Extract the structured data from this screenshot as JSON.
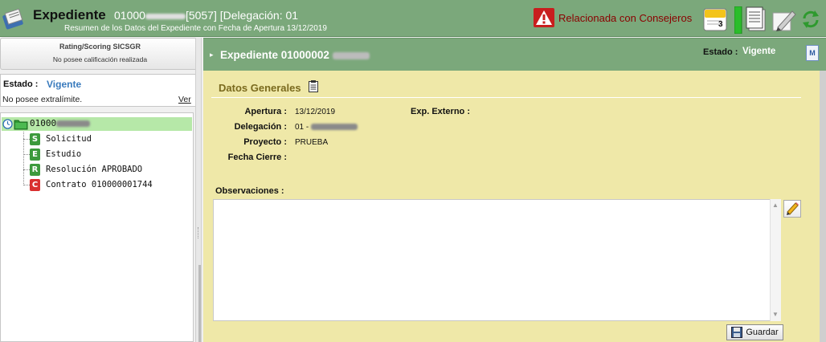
{
  "header": {
    "title": "Expediente",
    "id_prefix": "01000",
    "id_suffix": "[5057] [Delegación: 01",
    "subtitle": "Resumen de los Datos del Expediente con Fecha de Apertura 13/12/2019",
    "alert_label": "Relacionada con Consejeros",
    "calendar_number": "3",
    "tools": [
      "notebook-icon",
      "progress-bar-icon",
      "document-icon",
      "edit-pencil-icon",
      "refresh-icon"
    ]
  },
  "rating": {
    "title": "Rating/Scoring SICSGR",
    "text": "No posee calificación realizada"
  },
  "estado_panel": {
    "label": "Estado :",
    "value": "Vigente",
    "limite": "No posee extralímite.",
    "ver_link": "Ver"
  },
  "tree": {
    "root_label": "01000",
    "items": [
      {
        "letter": "S",
        "label": "Solicitud",
        "color": "#3c9a3c"
      },
      {
        "letter": "E",
        "label": "Estudio",
        "color": "#3c9a3c"
      },
      {
        "letter": "R",
        "label": "Resolución APROBADO",
        "color": "#3c9a3c"
      },
      {
        "letter": "C",
        "label": "Contrato 010000001744",
        "color": "#d93030"
      }
    ]
  },
  "right_header": {
    "title": "Expediente 01000002",
    "estado_label": "Estado :",
    "estado_value": "Vigente",
    "m_label": "M"
  },
  "datos_generales": {
    "title": "Datos Generales",
    "apertura_label": "Apertura :",
    "apertura_value": "13/12/2019",
    "exp_externo_label": "Exp. Externo :",
    "delegacion_label": "Delegación :",
    "delegacion_value": "01 -",
    "proyecto_label": "Proyecto :",
    "proyecto_value": "PRUEBA",
    "fecha_cierre_label": "Fecha Cierre :"
  },
  "observaciones": {
    "label": "Observaciones :",
    "value": ""
  },
  "save_button": {
    "label": "Guardar"
  },
  "colors": {
    "header_green": "#7ba87b",
    "content_yellow": "#efe8a8",
    "alert_red": "#8b0000",
    "estado_blue": "#3a7bbd",
    "tree_highlight": "#b6e8a8"
  }
}
